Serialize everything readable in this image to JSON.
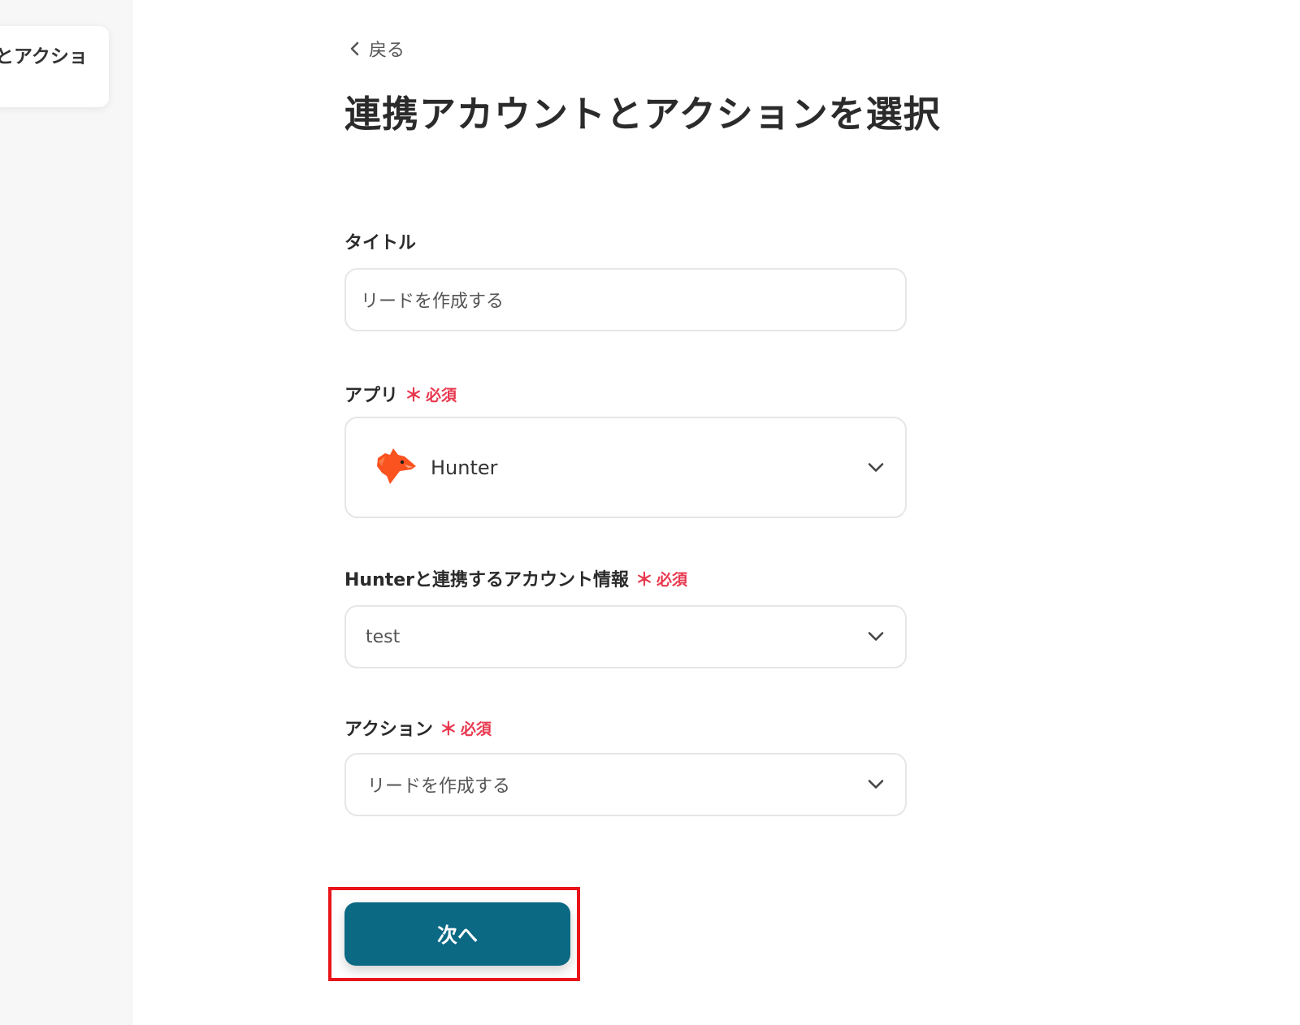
{
  "sidebar": {
    "card_text": "とアクショ"
  },
  "header": {
    "back_label": "戻る",
    "title": "連携アカウントとアクションを選択"
  },
  "form": {
    "title_field": {
      "label": "タイトル",
      "value": "リードを作成する"
    },
    "app_field": {
      "label": "アプリ",
      "required_mark": "＊",
      "required_text": "必須",
      "value": "Hunter",
      "icon": "hunter-fox-logo",
      "icon_color": "#fa5320"
    },
    "account_field": {
      "label": "Hunterと連携するアカウント情報",
      "required_mark": "＊",
      "required_text": "必須",
      "value": "test"
    },
    "action_field": {
      "label": "アクション",
      "required_mark": "＊",
      "required_text": "必須",
      "value": "リードを作成する"
    }
  },
  "actions": {
    "next_label": "次へ"
  },
  "colors": {
    "primary": "#0b6984",
    "required": "#e8384f",
    "highlight": "#e8141a"
  }
}
